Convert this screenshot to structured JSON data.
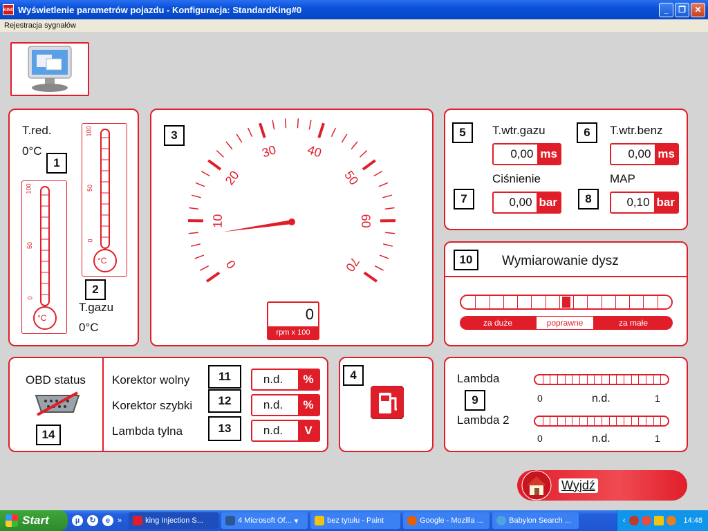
{
  "window": {
    "title": "Wyświetlenie parametrów pojazdu - Konfiguracja: StandardKing#0",
    "app_icon_text": "KING",
    "controls": {
      "minimize": "_",
      "maximize": "❐",
      "close": "✕"
    }
  },
  "menu": {
    "items": [
      "Rejestracja sygnałów"
    ]
  },
  "temps": {
    "reducer_label": "T.red.",
    "reducer_value": "0°C",
    "reducer_num": "1",
    "gas_num": "2",
    "gas_label": "T.gazu",
    "gas_value": "0°C",
    "scale": [
      "100",
      "50",
      "0"
    ],
    "unit": "°C",
    "reducer_level": 0,
    "gas_level": 0
  },
  "tacho": {
    "num": "3",
    "ticks": [
      "0",
      "10",
      "20",
      "30",
      "40",
      "50",
      "60",
      "70"
    ],
    "value": "0",
    "unit": "rpm x 100",
    "needle_rpm": 0
  },
  "injection": {
    "n5": "5",
    "l5": "T.wtr.gazu",
    "v5": "0,00",
    "u5": "ms",
    "n6": "6",
    "l6": "T.wtr.benz",
    "v6": "0,00",
    "u6": "ms",
    "n7": "7",
    "l7": "Ciśnienie",
    "v7": "0,00",
    "u7": "bar",
    "n8": "8",
    "l8": "MAP",
    "v8": "0,10",
    "u8": "bar"
  },
  "nozzle": {
    "num": "10",
    "title": "Wymiarowanie dysz",
    "too_big": "za duże",
    "correct": "poprawne",
    "too_small": "za małe",
    "level": 0.5
  },
  "obd": {
    "status_label": "OBD status",
    "num": "14",
    "rows": [
      {
        "label": "Korektor wolny",
        "num": "11",
        "value": "n.d.",
        "unit": "%"
      },
      {
        "label": "Korektor szybki",
        "num": "12",
        "value": "n.d.",
        "unit": "%"
      },
      {
        "label": "Lambda tylna",
        "num": "13",
        "value": "n.d.",
        "unit": "V"
      }
    ]
  },
  "fuel": {
    "num": "4"
  },
  "lambda": {
    "num": "9",
    "l1": "Lambda",
    "l2": "Lambda 2",
    "min": "0",
    "max": "1",
    "value": "n.d."
  },
  "exit": {
    "label": "Wyjdź"
  },
  "taskbar": {
    "start": "Start",
    "tasks": [
      "king Injection S...",
      "4 Microsoft Of...",
      "bez tytułu - Paint",
      "Google - Mozilla ...",
      "Babylon Search ..."
    ],
    "clock": "14:48"
  }
}
